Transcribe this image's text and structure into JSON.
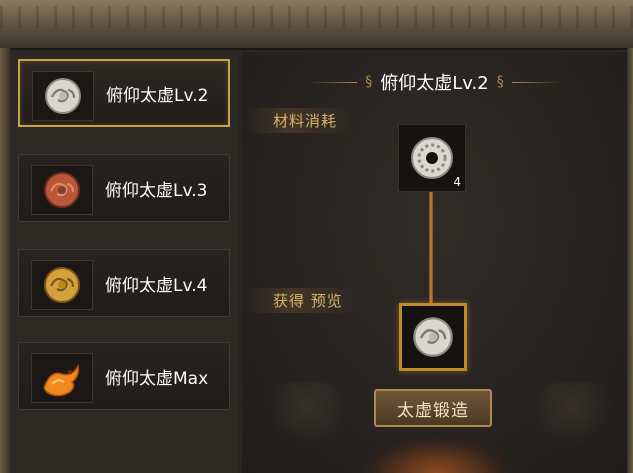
{
  "items": [
    {
      "label": "俯仰太虚Lv.2",
      "icon": "silver-dragon-disc-icon",
      "color": "#e6e2da",
      "selected": true
    },
    {
      "label": "俯仰太虚Lv.3",
      "icon": "red-dragon-disc-icon",
      "color": "#c05a3c",
      "selected": false
    },
    {
      "label": "俯仰太虚Lv.4",
      "icon": "gold-dragon-disc-icon",
      "color": "#d8a840",
      "selected": false
    },
    {
      "label": "俯仰太虚Max",
      "icon": "orange-dragon-icon",
      "color": "#ef8a1c",
      "selected": false
    }
  ],
  "detail": {
    "title": "俯仰太虚Lv.2",
    "materials_label": "材料消耗",
    "material": {
      "icon": "silver-ring-disc-icon",
      "count": "4"
    },
    "result_label": "获得 预览",
    "result": {
      "icon": "silver-dragon-disc-icon"
    },
    "forge_button": "太虚锻造"
  },
  "colors": {
    "accent": "#c9a24a",
    "label_gold": "#d9b26a"
  }
}
